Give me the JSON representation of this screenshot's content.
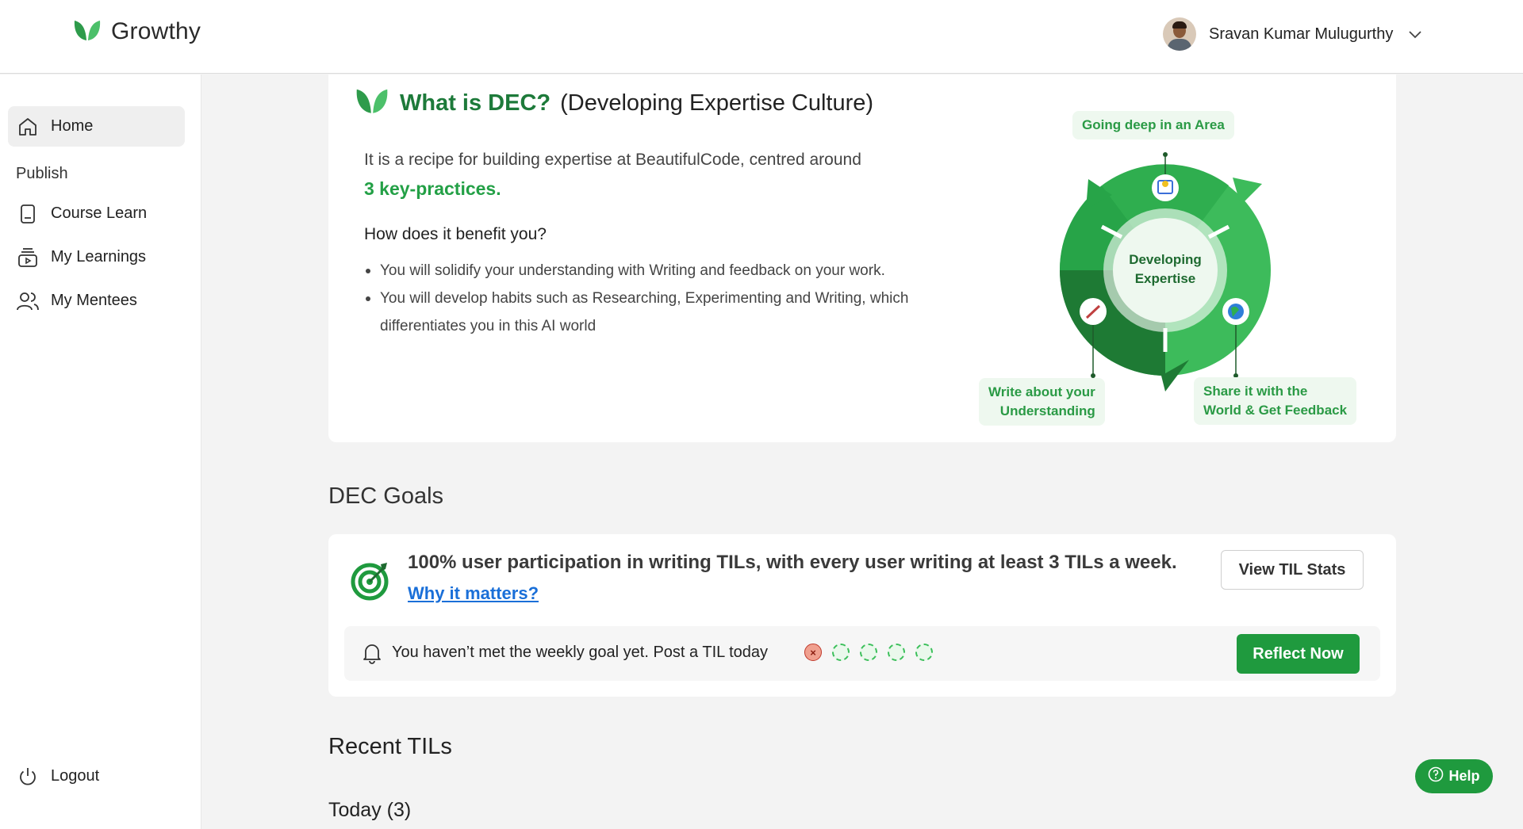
{
  "header": {
    "brand": "Growthy",
    "user_name": "Sravan Kumar Mulugurthy"
  },
  "sidebar": {
    "items": [
      {
        "label": "Home",
        "icon": "home-icon"
      },
      {
        "label": "Course Learn",
        "icon": "book-icon"
      },
      {
        "label": "My Learnings",
        "icon": "video-stack-icon"
      },
      {
        "label": "My Mentees",
        "icon": "users-icon"
      }
    ],
    "section_label": "Publish",
    "logout_label": "Logout"
  },
  "dec": {
    "title_highlight": "What is DEC?",
    "title_rest": "(Developing Expertise Culture)",
    "recipe_text": "It is a recipe for building expertise at BeautifulCode, centred around",
    "key_practices": "3 key-practices.",
    "benefit_question": "How does it benefit you?",
    "benefits": [
      "You will solidify your understanding with Writing and feedback on your work.",
      "You will develop habits such as Researching, Experimenting and Writing, which differentiates you in this AI world"
    ],
    "diagram": {
      "center_line1": "Developing",
      "center_line2": "Expertise",
      "label_top": "Going deep in an Area",
      "label_left_1": "Write about your",
      "label_left_2": "Understanding",
      "label_right_1": "Share it with the",
      "label_right_2": "World & Get Feedback",
      "colors": {
        "dark": "#1e7a34",
        "mid": "#27a448",
        "light": "#3dbb5b"
      }
    }
  },
  "goals": {
    "section_title": "DEC Goals",
    "goal_text": "100% user participation in writing TILs, with every user writing at least 3 TILs a week.",
    "why_link": "Why it matters?",
    "view_stats_button": "View TIL Stats",
    "reminder_text": "You haven’t met the weekly goal yet. Post a TIL today",
    "reflect_button": "Reflect Now",
    "week_status": [
      "missed",
      "pending",
      "pending",
      "pending",
      "pending"
    ]
  },
  "recent": {
    "section_title": "Recent TILs",
    "today_label": "Today (3)"
  },
  "help": {
    "label": "Help"
  },
  "colors": {
    "brand_green": "#1f9a3e",
    "link_blue": "#1a6fd8"
  }
}
